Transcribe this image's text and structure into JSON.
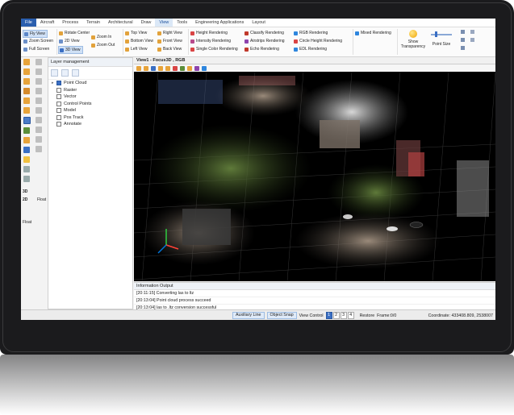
{
  "menu": [
    "File",
    "Aircraft",
    "Process",
    "Terrain",
    "Architectural",
    "Draw",
    "View",
    "Tools",
    "Engineering Applications",
    "Layout"
  ],
  "active_menu": "View",
  "ribbon": {
    "fly_view": "Fly View",
    "zoom_screen": "Zoom Screen",
    "full_screen": "Full Screen",
    "rotate_center": "Rotate Center",
    "view_2d": "2D View",
    "view_3d": "3D View",
    "zoom_in": "Zoom In",
    "zoom_out": "Zoom Out",
    "top_view": "Top View",
    "bottom_view": "Bottom View",
    "left_view": "Left View",
    "right_view": "Right View",
    "front_view": "Front View",
    "back_view": "Back View",
    "height_rendering": "Height Rendering",
    "intensity_rendering": "Intensity Rendering",
    "single_color_rendering": "Single Color Rendering",
    "classify_rendering": "Classify Rendering",
    "airstrips_rendering": "Airstrips Rendering",
    "echo_rendering": "Echo Rendering",
    "rgb_rendering": "RGB Rendering",
    "circle_height_rendering": "Circle Height Rendering",
    "edl_rendering": "EDL Rendering",
    "mixed_rendering": "Mixed Rendering",
    "show_transparency": "Show Transparency",
    "point_size": "Point Size"
  },
  "side": {
    "label_3d": "3D",
    "label_2d": "2D",
    "float_label": "Float",
    "float_label2": "Float"
  },
  "layer_panel": {
    "title": "Layer management",
    "items": [
      {
        "label": "Point Cloud",
        "checked": true
      },
      {
        "label": "Raster",
        "checked": false
      },
      {
        "label": "Vector",
        "checked": false
      },
      {
        "label": "Control Points",
        "checked": false
      },
      {
        "label": "Model",
        "checked": false
      },
      {
        "label": "Pos Track",
        "checked": false
      },
      {
        "label": "Annotate",
        "checked": false
      }
    ]
  },
  "viewport": {
    "title": "View1 - Focus3D , RGB"
  },
  "info": {
    "title": "Information Output",
    "lines": [
      "[20:11:15] Converting las to ltz",
      "[20:13:04] Point cloud process succeed",
      "[20:13:04] las to .ltz conversion successful"
    ]
  },
  "status": {
    "auxiliary_line": "Auxiliary Line",
    "object_snap": "Object Snap",
    "view_control": "View Control",
    "pages": [
      "1",
      "2",
      "3",
      "4"
    ],
    "active_page": "1",
    "restore": "Restore",
    "frame": "Frame:0/0",
    "coordinate": "Coordinate: 433408.809, 2538007"
  },
  "colors": {
    "accent": "#3a6fc4",
    "selected": "#cfe0f5",
    "viewport_bg": "#000000"
  }
}
